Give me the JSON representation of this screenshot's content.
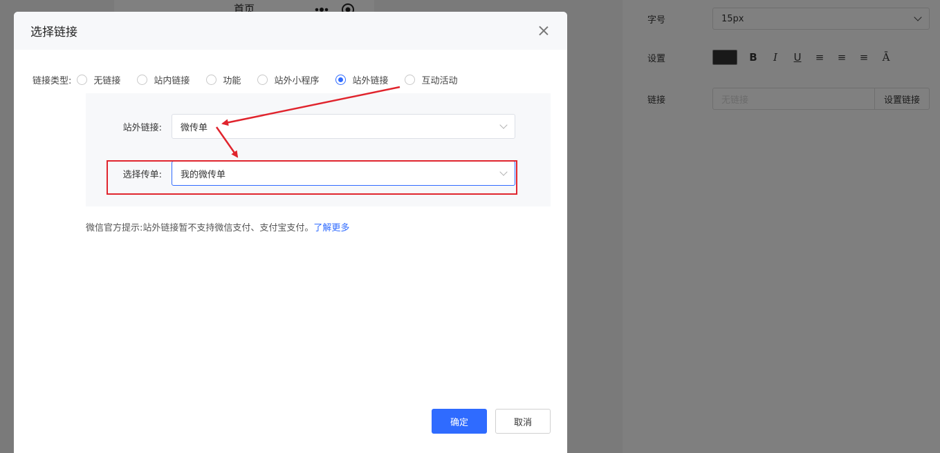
{
  "background": {
    "phone_title": "首页",
    "settings": {
      "font_size_label": "字号",
      "font_size_value": "15px",
      "style_label": "设置",
      "style_tools": [
        "B",
        "I",
        "U",
        "≡",
        "≡",
        "≡",
        "Ā"
      ],
      "link_label": "链接",
      "link_placeholder": "无链接",
      "link_button": "设置链接"
    }
  },
  "modal": {
    "title": "选择链接",
    "link_type_label": "链接类型:",
    "link_types": [
      {
        "label": "无链接",
        "checked": false
      },
      {
        "label": "站内链接",
        "checked": false
      },
      {
        "label": "功能",
        "checked": false
      },
      {
        "label": "站外小程序",
        "checked": false
      },
      {
        "label": "站外链接",
        "checked": true
      },
      {
        "label": "互动活动",
        "checked": false
      }
    ],
    "external_link_label": "站外链接:",
    "external_link_value": "微传单",
    "choose_flyer_label": "选择传单:",
    "choose_flyer_value": "我的微传单",
    "tip_text": "微信官方提示:站外链接暂不支持微信支付、支付宝支付。",
    "tip_link": "了解更多",
    "ok_button": "确定",
    "cancel_button": "取消"
  },
  "colors": {
    "accent": "#2f6bff",
    "annotation_red": "#e0242d"
  }
}
